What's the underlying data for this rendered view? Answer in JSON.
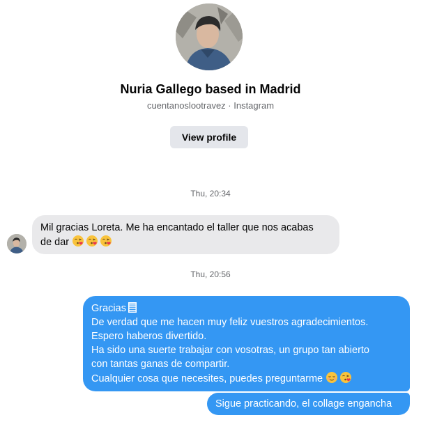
{
  "profile": {
    "name": "Nuria Gallego based in Madrid",
    "subtitle": "cuentanoslootravez · Instagram",
    "view_profile_label": "View profile",
    "avatar_icon": "profile-photo"
  },
  "conversation": {
    "timestamp_1": "Thu, 20:34",
    "timestamp_2": "Thu, 20:56",
    "incoming_message": {
      "line_1": "Mil gracias Loreta. Me ha encantado el taller que nos acabas",
      "line_2": "de dar",
      "emojis": [
        "kissing-heart-emoji",
        "kissing-heart-emoji",
        "kissing-heart-emoji"
      ]
    },
    "outgoing_message_1": {
      "line_1": "Gracias",
      "line_1_icon": "document-icon",
      "line_2": "De verdad que me hacen muy feliz vuestros agradecimientos.",
      "line_3": "Espero haberos divertido.",
      "line_4": "Ha sido una suerte trabajar con vosotras, un grupo tan abierto",
      "line_5": "con tantas ganas de compartir.",
      "line_6": "Cualquier cosa que necesites, puedes preguntarme",
      "line_6_emojis": [
        "relieved-emoji",
        "kissing-heart-emoji"
      ]
    },
    "outgoing_message_2": {
      "text": "Sigue practicando, el collage engancha"
    }
  },
  "colors": {
    "outgoing_bubble": "#3497f3",
    "incoming_bubble": "#e9e9eb",
    "secondary_text": "#65676b",
    "button_bg": "#e4e6eb"
  }
}
